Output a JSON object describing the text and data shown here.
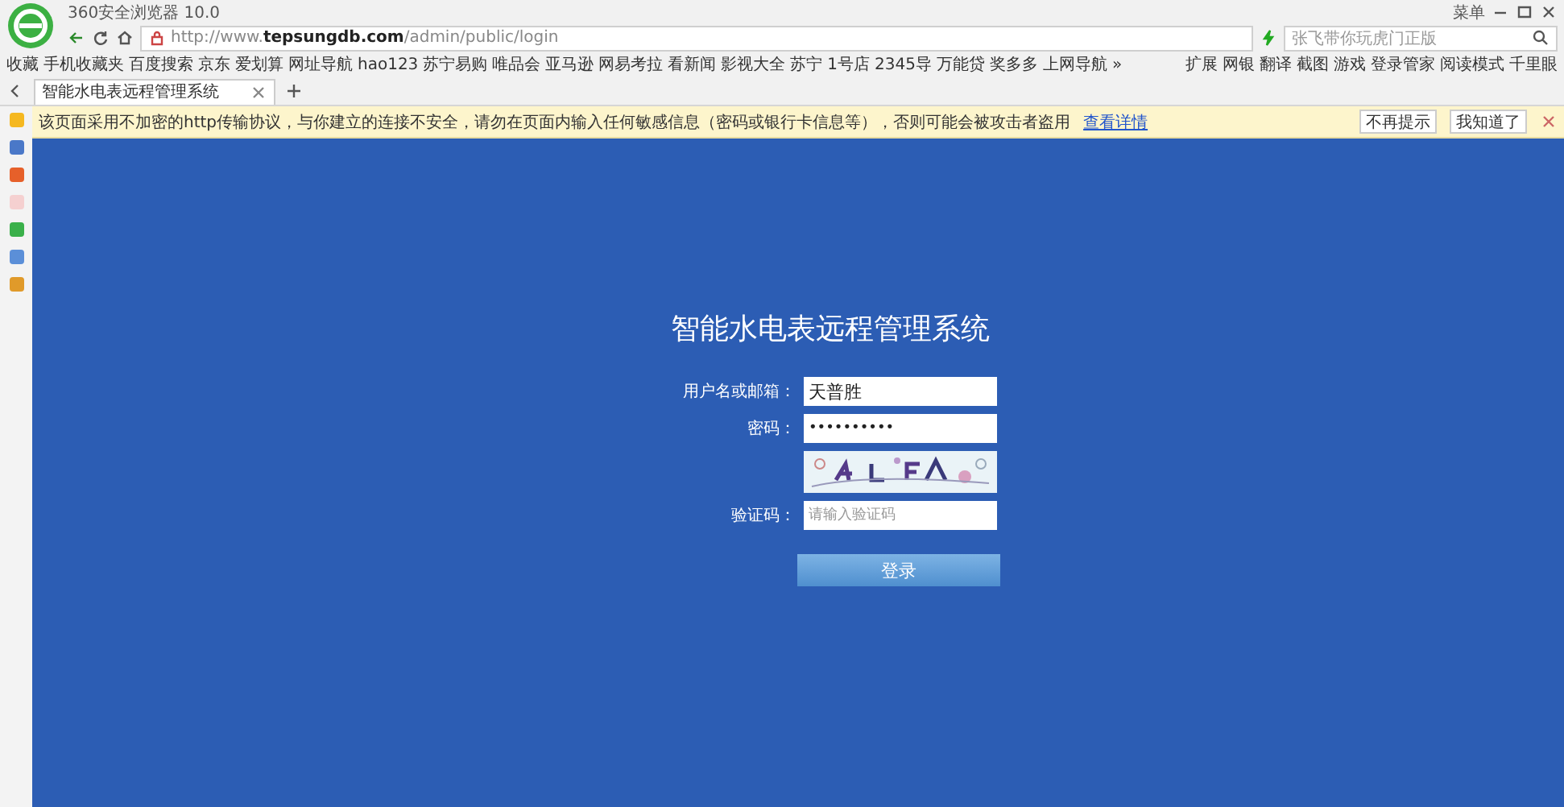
{
  "window": {
    "title": "360安全浏览器 10.0",
    "menu": "菜单"
  },
  "address_bar": {
    "url_prefix": "http://www.",
    "url_domain": "tepsungdb.com",
    "url_path": "/admin/public/login",
    "search_placeholder": "张飞带你玩虎门正版"
  },
  "bookmarks": [
    {
      "label": "收藏"
    },
    {
      "label": "手机收藏夹"
    },
    {
      "label": "百度搜索"
    },
    {
      "label": "京东"
    },
    {
      "label": "爱划算"
    },
    {
      "label": "网址导航"
    },
    {
      "label": "hao123"
    },
    {
      "label": "苏宁易购"
    },
    {
      "label": "唯品会"
    },
    {
      "label": "亚马逊"
    },
    {
      "label": "网易考拉"
    },
    {
      "label": "看新闻"
    },
    {
      "label": "影视大全"
    },
    {
      "label": "苏宁"
    },
    {
      "label": "1号店"
    },
    {
      "label": "2345导"
    },
    {
      "label": "万能贷"
    },
    {
      "label": "奖多多"
    },
    {
      "label": "上网导航"
    }
  ],
  "bookmarks_more": "»",
  "tools": [
    {
      "label": "扩展"
    },
    {
      "label": "网银"
    },
    {
      "label": "翻译"
    },
    {
      "label": "截图"
    },
    {
      "label": "游戏"
    },
    {
      "label": "登录管家"
    },
    {
      "label": "阅读模式"
    },
    {
      "label": "千里眼"
    }
  ],
  "tabs": [
    {
      "label": "智能水电表远程管理系统",
      "selected": true
    }
  ],
  "notice": {
    "text": "该页面采用不加密的http传输协议，与你建立的连接不安全，请勿在页面内输入任何敏感信息（密码或银行卡信息等），否则可能会被攻击者盗用",
    "link": "查看详情",
    "buttons": [
      "不再提示",
      "我知道了"
    ]
  },
  "login": {
    "title": "智能水电表远程管理系统",
    "username_label": "用户名或邮箱：",
    "username": "天普胜",
    "password_label": "密码：",
    "password": "••••••••••",
    "captcha_label": "验证码：",
    "captcha_placeholder": "请输入验证码",
    "submit": "登录"
  }
}
